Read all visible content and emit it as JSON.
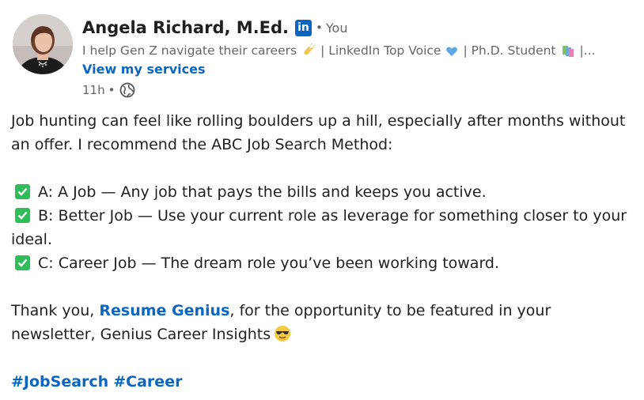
{
  "author": {
    "name": "Angela Richard, M.Ed.",
    "badge": "in",
    "separator": "•",
    "relation": "You",
    "headline_part1": "I help Gen Z navigate their careers",
    "headline_part2": "| LinkedIn Top Voice",
    "headline_part3": "| Ph.D. Student",
    "headline_part4": "|...",
    "services_link": "View my services",
    "time": "11h",
    "time_separator": "•"
  },
  "post": {
    "intro": "Job hunting can feel like rolling boulders up a hill, especially after months without an offer. I recommend the ABC Job Search Method:",
    "items": [
      "A: A Job — Any job that pays the bills and keeps you active.",
      "B: Better Job — Use your current role as leverage for something closer to your ideal.",
      "C: Career Job — The dream role you’ve been working toward."
    ],
    "thanks_before": "Thank you, ",
    "thanks_link": "Resume Genius",
    "thanks_after": ", for the opportunity to be featured in your newsletter, Genius Career Insights",
    "hashtag_1": "#JobSearch",
    "hashtag_2": "#Career"
  },
  "colors": {
    "link": "#0a66c2",
    "check": "#2ebd59",
    "secondary_text": "#666666"
  },
  "icons": [
    "linkedin-badge-icon",
    "clapping-hands-icon",
    "blue-heart-icon",
    "books-icon",
    "globe-icon",
    "check-mark-icon",
    "sunglasses-smiley-icon"
  ]
}
